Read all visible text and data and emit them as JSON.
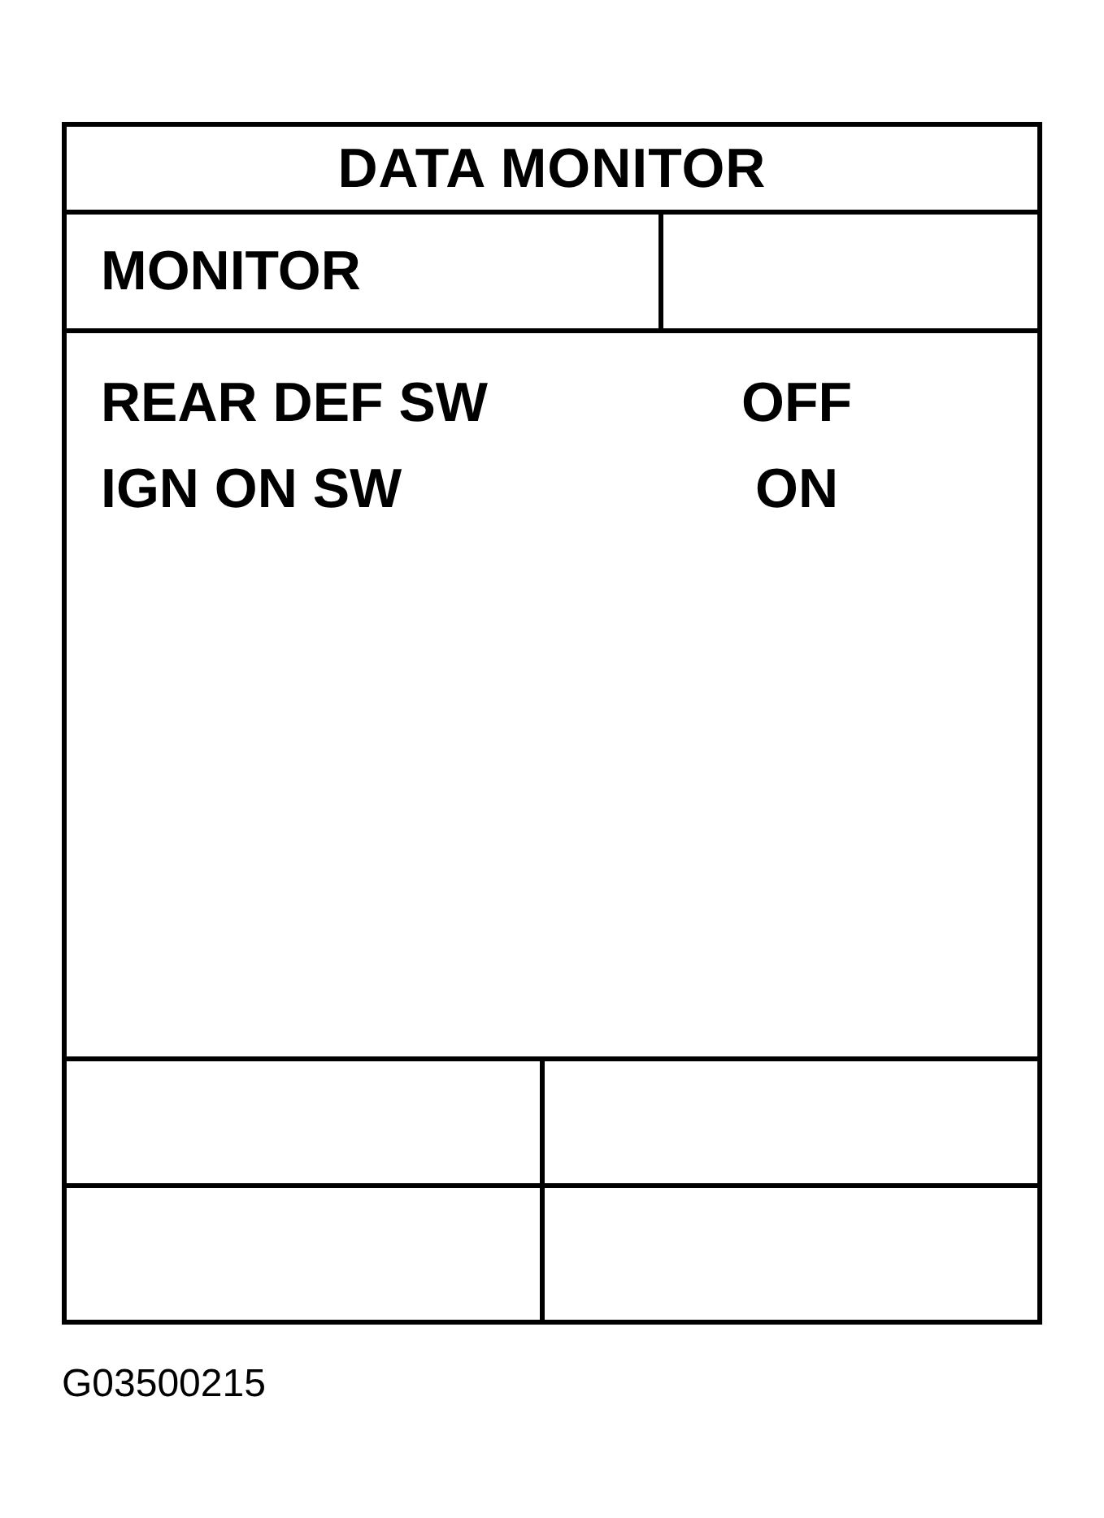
{
  "title": "DATA MONITOR",
  "header": {
    "label": "MONITOR"
  },
  "items": [
    {
      "name": "REAR DEF SW",
      "value": "OFF"
    },
    {
      "name": "IGN ON SW",
      "value": "ON"
    }
  ],
  "figure_code": "G03500215"
}
